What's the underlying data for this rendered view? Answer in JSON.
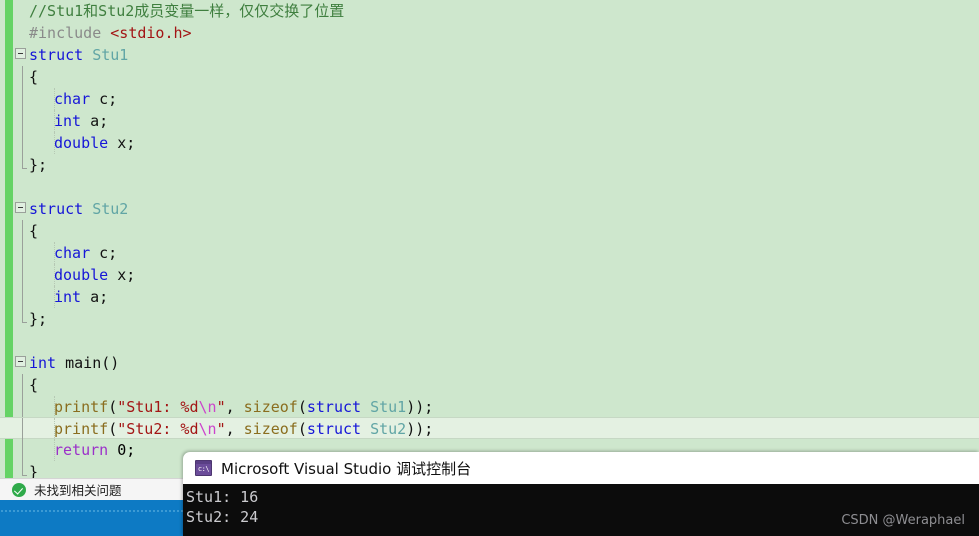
{
  "editor": {
    "lines": [
      {
        "indent": 0,
        "fold": false,
        "outline": "none",
        "guide": false,
        "current": false,
        "tokens": [
          {
            "t": "//Stu1和Stu2成员变量一样，仅仅交换了位置",
            "c": "cm"
          }
        ]
      },
      {
        "indent": 0,
        "fold": false,
        "outline": "none",
        "guide": false,
        "current": false,
        "tokens": [
          {
            "t": "#include ",
            "c": "pp"
          },
          {
            "t": "<stdio.h>",
            "c": "hdr"
          }
        ]
      },
      {
        "indent": 0,
        "fold": true,
        "outline": "none",
        "guide": false,
        "current": false,
        "tokens": [
          {
            "t": "struct ",
            "c": "kw"
          },
          {
            "t": "Stu1",
            "c": "typeid"
          }
        ]
      },
      {
        "indent": 0,
        "fold": false,
        "outline": "line",
        "guide": false,
        "current": false,
        "tokens": [
          {
            "t": "{",
            "c": "plain"
          }
        ]
      },
      {
        "indent": 1,
        "fold": false,
        "outline": "line",
        "guide": true,
        "current": false,
        "tokens": [
          {
            "t": "char ",
            "c": "kw"
          },
          {
            "t": "c;",
            "c": "plain"
          }
        ]
      },
      {
        "indent": 1,
        "fold": false,
        "outline": "line",
        "guide": true,
        "current": false,
        "tokens": [
          {
            "t": "int ",
            "c": "kw"
          },
          {
            "t": "a;",
            "c": "plain"
          }
        ]
      },
      {
        "indent": 1,
        "fold": false,
        "outline": "line",
        "guide": true,
        "current": false,
        "tokens": [
          {
            "t": "double ",
            "c": "kw"
          },
          {
            "t": "x;",
            "c": "plain"
          }
        ]
      },
      {
        "indent": 0,
        "fold": false,
        "outline": "end",
        "guide": false,
        "current": false,
        "tokens": [
          {
            "t": "};",
            "c": "plain"
          }
        ]
      },
      {
        "indent": 0,
        "fold": false,
        "outline": "none",
        "guide": false,
        "current": false,
        "tokens": []
      },
      {
        "indent": 0,
        "fold": true,
        "outline": "none",
        "guide": false,
        "current": false,
        "tokens": [
          {
            "t": "struct ",
            "c": "kw"
          },
          {
            "t": "Stu2",
            "c": "typeid"
          }
        ]
      },
      {
        "indent": 0,
        "fold": false,
        "outline": "line",
        "guide": false,
        "current": false,
        "tokens": [
          {
            "t": "{",
            "c": "plain"
          }
        ]
      },
      {
        "indent": 1,
        "fold": false,
        "outline": "line",
        "guide": true,
        "current": false,
        "tokens": [
          {
            "t": "char ",
            "c": "kw"
          },
          {
            "t": "c;",
            "c": "plain"
          }
        ]
      },
      {
        "indent": 1,
        "fold": false,
        "outline": "line",
        "guide": true,
        "current": false,
        "tokens": [
          {
            "t": "double ",
            "c": "kw"
          },
          {
            "t": "x;",
            "c": "plain"
          }
        ]
      },
      {
        "indent": 1,
        "fold": false,
        "outline": "line",
        "guide": true,
        "current": false,
        "tokens": [
          {
            "t": "int ",
            "c": "kw"
          },
          {
            "t": "a;",
            "c": "plain"
          }
        ]
      },
      {
        "indent": 0,
        "fold": false,
        "outline": "end",
        "guide": false,
        "current": false,
        "tokens": [
          {
            "t": "};",
            "c": "plain"
          }
        ]
      },
      {
        "indent": 0,
        "fold": false,
        "outline": "none",
        "guide": false,
        "current": false,
        "tokens": []
      },
      {
        "indent": 0,
        "fold": true,
        "outline": "none",
        "guide": false,
        "current": false,
        "tokens": [
          {
            "t": "int ",
            "c": "kw"
          },
          {
            "t": "main()",
            "c": "plain"
          }
        ]
      },
      {
        "indent": 0,
        "fold": false,
        "outline": "line",
        "guide": false,
        "current": false,
        "tokens": [
          {
            "t": "{",
            "c": "plain"
          }
        ]
      },
      {
        "indent": 1,
        "fold": false,
        "outline": "line",
        "guide": true,
        "current": false,
        "tokens": [
          {
            "t": "printf",
            "c": "fn"
          },
          {
            "t": "(",
            "c": "plain"
          },
          {
            "t": "\"Stu1: %d",
            "c": "str"
          },
          {
            "t": "\\n",
            "c": "esc"
          },
          {
            "t": "\"",
            "c": "str"
          },
          {
            "t": ", ",
            "c": "plain"
          },
          {
            "t": "sizeof",
            "c": "fn"
          },
          {
            "t": "(",
            "c": "plain"
          },
          {
            "t": "struct ",
            "c": "kw"
          },
          {
            "t": "Stu1",
            "c": "typeid"
          },
          {
            "t": "));",
            "c": "plain"
          }
        ]
      },
      {
        "indent": 1,
        "fold": false,
        "outline": "line",
        "guide": true,
        "current": true,
        "tokens": [
          {
            "t": "printf",
            "c": "fn"
          },
          {
            "t": "(",
            "c": "plain"
          },
          {
            "t": "\"Stu2: %d",
            "c": "str"
          },
          {
            "t": "\\n",
            "c": "esc"
          },
          {
            "t": "\"",
            "c": "str"
          },
          {
            "t": ", ",
            "c": "plain"
          },
          {
            "t": "sizeof",
            "c": "fn"
          },
          {
            "t": "(",
            "c": "plain"
          },
          {
            "t": "struct ",
            "c": "kw"
          },
          {
            "t": "Stu2",
            "c": "typeid"
          },
          {
            "t": "));",
            "c": "plain"
          }
        ]
      },
      {
        "indent": 1,
        "fold": false,
        "outline": "line",
        "guide": true,
        "current": false,
        "tokens": [
          {
            "t": "return ",
            "c": "ctl"
          },
          {
            "t": "0;",
            "c": "num"
          }
        ]
      },
      {
        "indent": 0,
        "fold": false,
        "outline": "end",
        "guide": false,
        "current": false,
        "tokens": [
          {
            "t": "}",
            "c": "plain"
          }
        ]
      }
    ]
  },
  "errorbar": {
    "icon": "success-check-icon",
    "label": "未找到相关问题"
  },
  "console": {
    "icon": "console-app-icon",
    "icon_glyph": "c:\\",
    "title": "Microsoft Visual Studio 调试控制台",
    "output": [
      "Stu1: 16",
      "Stu2: 24"
    ],
    "watermark": "CSDN @Weraphael"
  },
  "colors": {
    "editor_background": "#cee7cd",
    "change_bar": "#65d365",
    "current_line": "#e4f1e2",
    "status_bar": "#0d7ac4",
    "console_background": "#0c0c0c",
    "console_text": "#ccccd0",
    "comment": "#3f7f3f",
    "keyword": "#1616d8",
    "string": "#a31515",
    "escape": "#cc44cc",
    "function": "#8a6d1e",
    "control": "#9b30c9",
    "typename": "#61a5a5"
  }
}
